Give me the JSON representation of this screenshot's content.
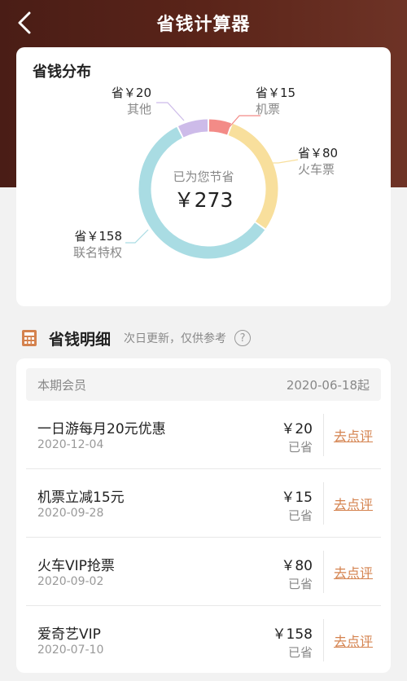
{
  "header": {
    "title": "省钱计算器",
    "back_icon": "chevron-left-icon"
  },
  "colors": {
    "header_bg": "#5a2419",
    "accent": "#d4824e",
    "seg_teal": "#a9dce3",
    "seg_yellow": "#f8df9c",
    "seg_pink": "#f38b87",
    "seg_purple": "#cdbbe9"
  },
  "distribution": {
    "title": "省钱分布",
    "center_caption": "已为您节省",
    "center_value": "￥273",
    "segments": [
      {
        "prefix": "省",
        "amount": "￥15",
        "name": "机票",
        "value": 15,
        "color": "#f38b87"
      },
      {
        "prefix": "省",
        "amount": "￥80",
        "name": "火车票",
        "value": 80,
        "color": "#f8df9c"
      },
      {
        "prefix": "省",
        "amount": "￥158",
        "name": "联名特权",
        "value": 158,
        "color": "#a9dce3"
      },
      {
        "prefix": "省",
        "amount": "￥20",
        "name": "其他",
        "value": 20,
        "color": "#cdbbe9"
      }
    ]
  },
  "details": {
    "title": "省钱明细",
    "note": "次日更新，仅供参考",
    "help_icon": "question-circle-icon",
    "calc_icon": "calculator-icon",
    "period_label": "本期会员",
    "period_start": "2020-06-18起",
    "rows": [
      {
        "title": "一日游每月20元优惠",
        "date": "2020-12-04",
        "amount": "￥20",
        "saved_label": "已省",
        "action": "去点评"
      },
      {
        "title": "机票立减15元",
        "date": "2020-09-28",
        "amount": "￥15",
        "saved_label": "已省",
        "action": "去点评"
      },
      {
        "title": "火车VIP抢票",
        "date": "2020-09-02",
        "amount": "￥80",
        "saved_label": "已省",
        "action": "去点评"
      },
      {
        "title": "爱奇艺VIP",
        "date": "2020-07-10",
        "amount": "￥158",
        "saved_label": "已省",
        "action": "去点评"
      }
    ]
  }
}
